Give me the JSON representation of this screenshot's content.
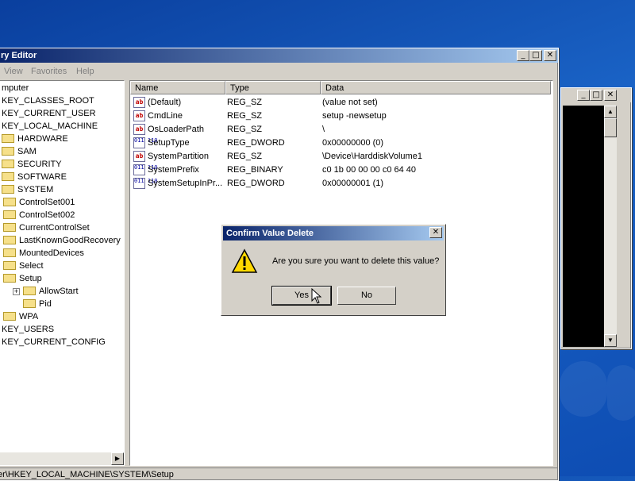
{
  "desktop": {
    "background": "#1a63c6"
  },
  "regedit": {
    "title": "ry Editor",
    "menu": [
      "View",
      "Favorites",
      "Help"
    ],
    "tree": [
      {
        "label": "mputer",
        "level": 0,
        "expander": "",
        "folder": false
      },
      {
        "label": "KEY_CLASSES_ROOT",
        "level": 0,
        "expander": "",
        "folder": false
      },
      {
        "label": "KEY_CURRENT_USER",
        "level": 0,
        "expander": "",
        "folder": false
      },
      {
        "label": "KEY_LOCAL_MACHINE",
        "level": 0,
        "expander": "",
        "folder": false
      },
      {
        "label": "HARDWARE",
        "level": 1,
        "expander": "",
        "folder": true
      },
      {
        "label": "SAM",
        "level": 1,
        "expander": "",
        "folder": true
      },
      {
        "label": "SECURITY",
        "level": 1,
        "expander": "",
        "folder": true
      },
      {
        "label": "SOFTWARE",
        "level": 1,
        "expander": "",
        "folder": true
      },
      {
        "label": "SYSTEM",
        "level": 1,
        "expander": "",
        "folder": true
      },
      {
        "label": "ControlSet001",
        "level": 2,
        "expander": "",
        "folder": true
      },
      {
        "label": "ControlSet002",
        "level": 2,
        "expander": "",
        "folder": true
      },
      {
        "label": "CurrentControlSet",
        "level": 2,
        "expander": "",
        "folder": true
      },
      {
        "label": "LastKnownGoodRecovery",
        "level": 2,
        "expander": "",
        "folder": true
      },
      {
        "label": "MountedDevices",
        "level": 2,
        "expander": "",
        "folder": true
      },
      {
        "label": "Select",
        "level": 2,
        "expander": "",
        "folder": true
      },
      {
        "label": "Setup",
        "level": 2,
        "expander": "",
        "folder": true
      },
      {
        "label": "AllowStart",
        "level": 3,
        "expander": "+",
        "folder": true
      },
      {
        "label": "Pid",
        "level": 3,
        "expander": "",
        "folder": true
      },
      {
        "label": "WPA",
        "level": 2,
        "expander": "",
        "folder": true
      },
      {
        "label": "KEY_USERS",
        "level": 0,
        "expander": "",
        "folder": false
      },
      {
        "label": "KEY_CURRENT_CONFIG",
        "level": 0,
        "expander": "",
        "folder": false
      }
    ],
    "columns": [
      "Name",
      "Type",
      "Data"
    ],
    "values": [
      {
        "icon": "string-value-icon",
        "name": "(Default)",
        "type": "REG_SZ",
        "data": "(value not set)"
      },
      {
        "icon": "string-value-icon",
        "name": "CmdLine",
        "type": "REG_SZ",
        "data": "setup -newsetup"
      },
      {
        "icon": "string-value-icon",
        "name": "OsLoaderPath",
        "type": "REG_SZ",
        "data": "\\"
      },
      {
        "icon": "binary-value-icon",
        "name": "SetupType",
        "type": "REG_DWORD",
        "data": "0x00000000 (0)"
      },
      {
        "icon": "string-value-icon",
        "name": "SystemPartition",
        "type": "REG_SZ",
        "data": "\\Device\\HarddiskVolume1"
      },
      {
        "icon": "binary-value-icon",
        "name": "SystemPrefix",
        "type": "REG_BINARY",
        "data": "c0 1b 00 00 00 c0 64 40"
      },
      {
        "icon": "binary-value-icon",
        "name": "SystemSetupInPr...",
        "type": "REG_DWORD",
        "data": "0x00000001 (1)"
      }
    ],
    "status": "er\\HKEY_LOCAL_MACHINE\\SYSTEM\\Setup"
  },
  "dialog": {
    "title": "Confirm Value Delete",
    "message": "Are you sure you want to delete this value?",
    "yes_label": "Yes",
    "no_label": "No",
    "close_glyph": "✕"
  },
  "window_buttons": {
    "minimize": "_",
    "maximize": "□",
    "close": "✕"
  }
}
